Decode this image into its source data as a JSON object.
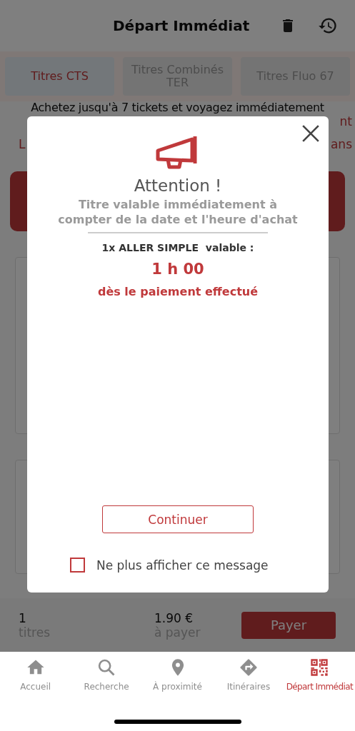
{
  "header": {
    "title": "Départ Immédiat"
  },
  "ticket_tabs": [
    {
      "label": "Titres CTS",
      "selected": true
    },
    {
      "label": "Titres Combinés TER",
      "selected": false
    },
    {
      "label": "Titres Fluo 67",
      "selected": false
    }
  ],
  "intro": {
    "text": "Achetez jusqu'à 7 tickets et voyagez immédiatement",
    "fragment_rows": [
      {
        "right": "nt"
      },
      {
        "left": "L",
        "right": "ans"
      }
    ]
  },
  "cart": {
    "count": "1",
    "count_label": "titres",
    "total": "1.90 €",
    "total_label": "à payer",
    "pay_button": "Payer"
  },
  "modal": {
    "title": "Attention !",
    "message": "Titre valable immédiatement à compter de la date et l'heure d'achat",
    "validity": "**1x ALLER SIMPLE**  valable :",
    "duration": "1 h 00",
    "duration_note": "dès le paiement effectué",
    "continue_button": "Continuer",
    "dont_show": {
      "label": "Ne plus afficher ce message",
      "checked": false
    }
  },
  "nav": [
    {
      "label": "Accueil",
      "kind": "home",
      "selected": false
    },
    {
      "label": "Recherche",
      "kind": "search",
      "selected": false
    },
    {
      "label": "À proximité",
      "kind": "pin",
      "selected": false
    },
    {
      "label": "Itinéraires",
      "kind": "route",
      "selected": false
    },
    {
      "label": "Départ Immédiat",
      "kind": "qr",
      "selected": true
    }
  ]
}
